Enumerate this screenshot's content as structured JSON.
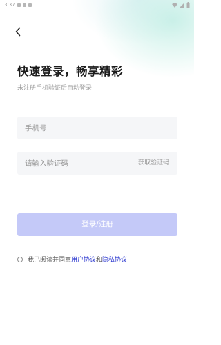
{
  "status_bar": {
    "time": "3:37",
    "icons": [
      "notification-icon",
      "app-icon",
      "battery-icon",
      "wifi-icon",
      "signal-icon"
    ]
  },
  "nav": {
    "back_icon": "chevron-left-icon"
  },
  "title": "快速登录，畅享精彩",
  "subtitle": "未注册手机验证后自动登录",
  "phone": {
    "placeholder": "手机号",
    "value": ""
  },
  "code": {
    "placeholder": "请输入验证码",
    "value": "",
    "get_code_label": "获取验证码"
  },
  "submit_label": "登录/注册",
  "agreement": {
    "prefix": "我已阅读并同意",
    "user_agreement": "用户协议",
    "conjunction": "和",
    "privacy_agreement": "隐私协议",
    "checked": false
  },
  "colors": {
    "link": "#2f3bd0",
    "submit_disabled": "#c4c9f8",
    "field_bg": "#f5f6f8"
  }
}
